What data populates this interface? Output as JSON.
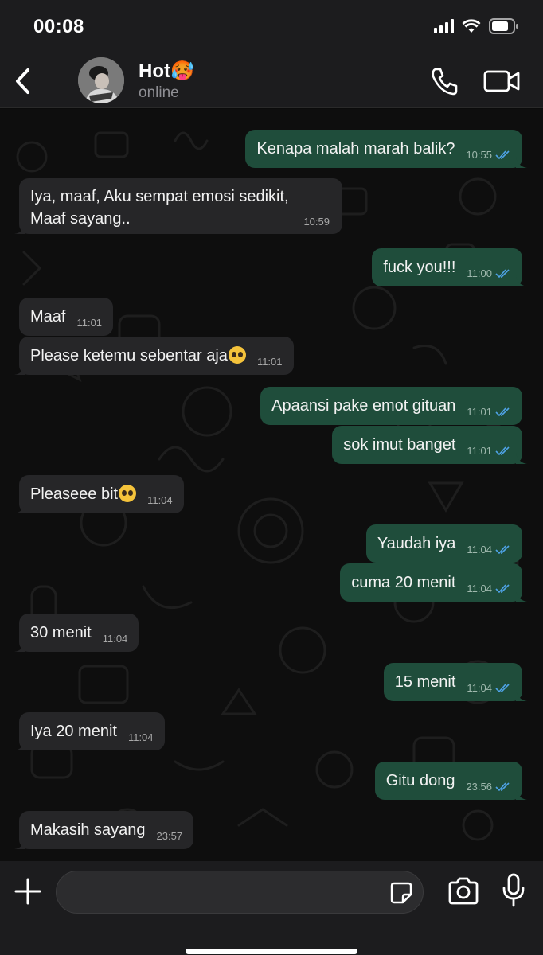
{
  "status_bar": {
    "time": "00:08"
  },
  "header": {
    "contact_name": "Hot🥵",
    "contact_status": "online"
  },
  "messages": [
    {
      "dir": "out",
      "text": "Kenapa malah marah balik?",
      "time": "10:55",
      "read": true
    },
    {
      "dir": "in",
      "line1": "Iya, maaf, Aku sempat emosi sedikit,",
      "line2": "Maaf sayang..",
      "time": "10:59"
    },
    {
      "dir": "out",
      "text": "fuck you!!!",
      "time": "11:00",
      "read": true
    },
    {
      "dir": "in",
      "text": "Maaf",
      "time": "11:01"
    },
    {
      "dir": "in",
      "text": "Please ketemu sebentar aja",
      "emoji": "pleading-face",
      "time": "11:01"
    },
    {
      "dir": "out",
      "text": "Apaansi pake emot gituan",
      "time": "11:01",
      "read": true
    },
    {
      "dir": "out",
      "text": "sok imut banget",
      "time": "11:01",
      "read": true
    },
    {
      "dir": "in",
      "text": "Pleaseee bit",
      "emoji": "pleading-face",
      "time": "11:04"
    },
    {
      "dir": "out",
      "text": "Yaudah iya",
      "time": "11:04",
      "read": true
    },
    {
      "dir": "out",
      "text": "cuma 20 menit",
      "time": "11:04",
      "read": true
    },
    {
      "dir": "in",
      "text": "30 menit",
      "time": "11:04"
    },
    {
      "dir": "out",
      "text": "15 menit",
      "time": "11:04",
      "read": true
    },
    {
      "dir": "in",
      "text": "Iya 20 menit",
      "time": "11:04"
    },
    {
      "dir": "out",
      "text": "Gitu dong",
      "time": "23:56",
      "read": true
    },
    {
      "dir": "in",
      "text": "Makasih sayang",
      "time": "23:57"
    }
  ],
  "input": {
    "placeholder": ""
  },
  "colors": {
    "outgoing_bubble": "#1f4d3b",
    "incoming_bubble": "#262628",
    "read_ticks": "#4fa3e8",
    "bars": "#1c1c1e"
  }
}
